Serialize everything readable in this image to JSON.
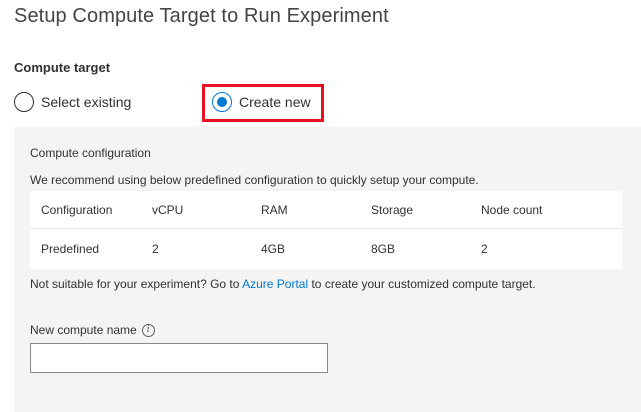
{
  "title": "Setup Compute Target to Run Experiment",
  "compute_target": {
    "label": "Compute target",
    "options": [
      {
        "label": "Select existing",
        "selected": false
      },
      {
        "label": "Create new",
        "selected": true
      }
    ]
  },
  "config": {
    "title": "Compute configuration",
    "recommendation": "We recommend using below predefined configuration to quickly setup your compute.",
    "table": {
      "headers": [
        "Configuration",
        "vCPU",
        "RAM",
        "Storage",
        "Node count"
      ],
      "row": [
        "Predefined",
        "2",
        "4GB",
        "8GB",
        "2"
      ]
    },
    "note": {
      "prefix": "Not suitable for your experiment? Go to ",
      "link": "Azure Portal",
      "suffix": " to create your customized compute target."
    },
    "name_field": {
      "label": "New compute name",
      "value": "",
      "placeholder": ""
    }
  },
  "colors": {
    "accent": "#0078d4",
    "highlight": "#e81123",
    "panel_bg": "#f4f4f4"
  }
}
